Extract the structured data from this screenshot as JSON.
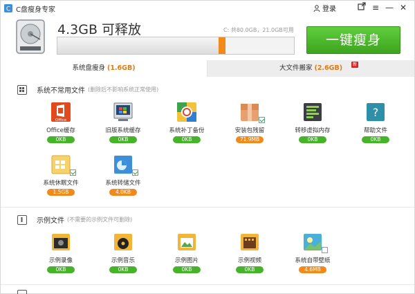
{
  "app": {
    "title": "C盘瘦身专家",
    "login_label": "登录",
    "accent": "#47b32a",
    "orange": "#f08a1c"
  },
  "header": {
    "freed": "4.3GB 可释放",
    "disk_info": "C: 共80.0GB，21.0GB可用",
    "progress_used_fraction": 0.71,
    "progress_highlight_fraction": 0.03,
    "one_click": "一键瘦身"
  },
  "tabs": [
    {
      "label": "系统盘瘦身",
      "amount": "(1.6GB)"
    },
    {
      "label": "大文件搬家",
      "amount": "(2.6GB)",
      "badge": "新"
    }
  ],
  "sections": [
    {
      "title": "系统不常用文件",
      "note": "(删除后不影响系统正常使用)",
      "items": [
        {
          "label": "Office缓存",
          "size": "0KB",
          "icon": "office-icon"
        },
        {
          "label": "旧版系统缓存",
          "size": "0KB",
          "icon": "old-system-icon"
        },
        {
          "label": "系统补丁备份",
          "size": "0KB",
          "icon": "patch-backup-icon"
        },
        {
          "label": "安装包残留",
          "size": "71.9MB",
          "icon": "package-icon"
        },
        {
          "label": "转移虚拟内存",
          "size": "0KB",
          "icon": "virtual-memory-icon"
        },
        {
          "label": "帮助文件",
          "size": "0KB",
          "icon": "help-icon"
        },
        {
          "label": "系统休眠文件",
          "size": "1.5GB",
          "icon": "hibernate-icon"
        },
        {
          "label": "系统转储文件",
          "size": "4.0KB",
          "icon": "dump-icon"
        }
      ]
    },
    {
      "title": "示例文件",
      "note": "(不需要的示例文件可删除)",
      "items": [
        {
          "label": "示例录像",
          "size": "0KB",
          "icon": "sample-video-icon"
        },
        {
          "label": "示例音乐",
          "size": "0KB",
          "icon": "sample-music-icon"
        },
        {
          "label": "示例图片",
          "size": "0KB",
          "icon": "sample-picture-icon"
        },
        {
          "label": "示例视频",
          "size": "0KB",
          "icon": "sample-film-icon"
        },
        {
          "label": "系统自带壁纸",
          "size": "4.6MB",
          "icon": "wallpaper-icon"
        }
      ]
    }
  ]
}
